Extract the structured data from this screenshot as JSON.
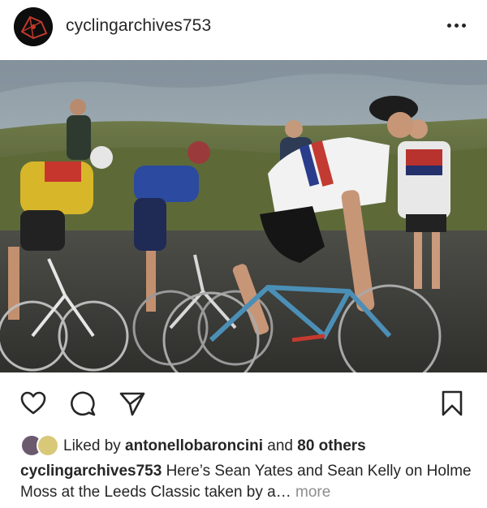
{
  "post": {
    "username": "cyclingarchives753",
    "more_icon": "ellipsis-icon",
    "photo_alt": "Sean Yates and Sean Kelly on Holme Moss at the Leeds Classic",
    "actions": {
      "like_icon": "heart-icon",
      "comment_icon": "comment-icon",
      "share_icon": "paper-plane-icon",
      "save_icon": "bookmark-icon"
    },
    "likes": {
      "prefix": "Liked by ",
      "user": "antonellobaroncini",
      "middle": " and ",
      "others": "80 others"
    },
    "caption": {
      "user": "cyclingarchives753",
      "text": " Here’s Sean Yates and Sean Kelly on Holme Moss at the Leeds Classic taken by a…",
      "more_label": "more"
    },
    "colors": {
      "text": "#262626",
      "muted": "#8e8e8e",
      "background": "#ffffff"
    }
  }
}
